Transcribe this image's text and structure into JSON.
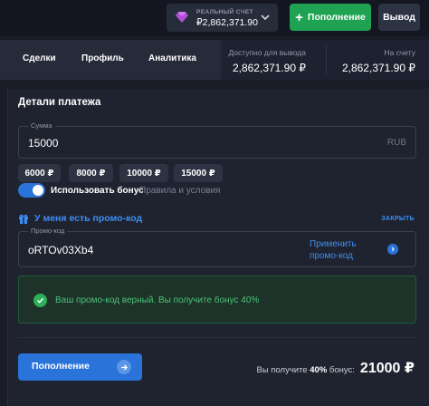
{
  "header": {
    "account": {
      "label": "РЕАЛЬНЫЙ СЧЕТ",
      "balance": "₽2,862,371.90",
      "icon": "gem-icon",
      "dropdown_icon": "chevron-down-icon"
    },
    "deposit_button": "Пополнение",
    "withdraw_button": "Вывод"
  },
  "nav": {
    "tabs": [
      "Сделки",
      "Профиль",
      "Аналитика"
    ],
    "available_label": "Доступно для вывода",
    "available_value": "2,862,371.90 ₽",
    "account_label": "На счету",
    "account_value": "2,862,371.90 ₽"
  },
  "payment": {
    "title": "Детали платежа",
    "amount_label": "Сумма",
    "amount_value": "15000",
    "currency": "RUB",
    "quick_amounts": [
      "6000 ₽",
      "8000 ₽",
      "10000 ₽",
      "15000 ₽"
    ],
    "bonus_toggle_label": "Использовать бонус",
    "bonus_toggle_on": true,
    "rules_link": "Правила и условия",
    "promo_header": "У меня есть промо-код",
    "collapse_link": "ЗАКРЫТЬ",
    "promo_label": "Промо-код",
    "promo_value": "oRTOv03Xb4",
    "apply_label": "Применить промо-код",
    "success_message": "Ваш промо-код верный. Вы получите бонус 40%",
    "submit_button": "Пополнение",
    "receive_prefix": "Вы получите",
    "receive_bonus": "40%",
    "receive_suffix": "бонус:",
    "receive_total": "21000 ₽"
  },
  "colors": {
    "background": "#1a1d27",
    "accent_blue": "#2a73d9",
    "accent_green": "#1fa353",
    "success_text": "#4cc277"
  }
}
